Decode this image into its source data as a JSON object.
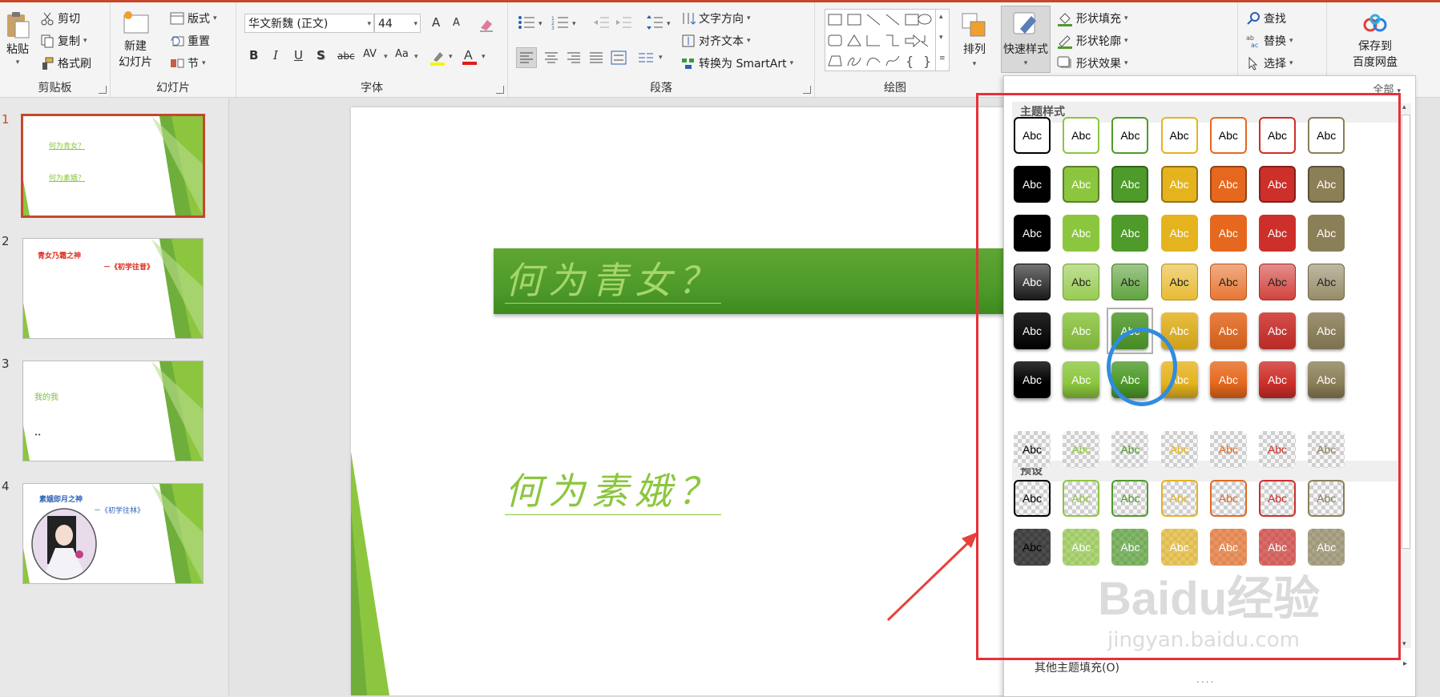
{
  "ribbon": {
    "clipboard": {
      "label": "剪贴板",
      "paste": "粘贴",
      "cut": "剪切",
      "copy": "复制",
      "format_painter": "格式刷"
    },
    "slides": {
      "label": "幻灯片",
      "new_slide": "新建\n幻灯片",
      "layout": "版式",
      "reset": "重置",
      "section": "节"
    },
    "font": {
      "label": "字体",
      "font_name": "华文新魏 (正文)",
      "font_size": "44",
      "bold": "B",
      "italic": "I",
      "underline": "U",
      "shadow": "S",
      "strike": "abc",
      "spacing": "AV",
      "case": "Aa",
      "grow": "A",
      "shrink": "A"
    },
    "paragraph": {
      "label": "段落",
      "text_direction": "文字方向",
      "align_text": "对齐文本",
      "smartart": "转换为 SmartArt"
    },
    "drawing": {
      "label": "绘图",
      "arrange": "排列",
      "quick_styles": "快速样式",
      "shape_fill": "形状填充",
      "shape_outline": "形状轮廓",
      "shape_effects": "形状效果"
    },
    "editing": {
      "find": "查找",
      "replace": "替换",
      "select": "选择"
    },
    "baidu": {
      "save": "保存到\n百度网盘"
    }
  },
  "slides": [
    {
      "number": "1",
      "lines": [
        "何为青女？",
        "何为素娥？"
      ],
      "color": "#8cc63f"
    },
    {
      "number": "2",
      "lines": [
        "青女乃霜之神",
        "－《初学往昔》"
      ],
      "color": "#e0281a"
    },
    {
      "number": "3",
      "lines": [
        "我的我",
        "••"
      ],
      "color": "#7dc13a"
    },
    {
      "number": "4",
      "lines": [
        "素娥即月之神",
        "－《初学往林》"
      ],
      "color": "#2b5fb4"
    }
  ],
  "slide": {
    "title1": "何为青女？",
    "title2": "何为素娥？"
  },
  "gallery": {
    "filter_label": "全部",
    "section_theme": "主题样式",
    "section_presets": "预设",
    "swatch_text": "Abc",
    "footer_item": "其他主题填充(O)",
    "footer_dots": "....",
    "colors": [
      "#000000",
      "#8cc63f",
      "#4e9a2a",
      "#e5b31e",
      "#e5681e",
      "#cd2f2a",
      "#8b7f58"
    ]
  },
  "watermark": {
    "line1": "Baidu经验",
    "line2": "jingyan.baidu.com"
  }
}
